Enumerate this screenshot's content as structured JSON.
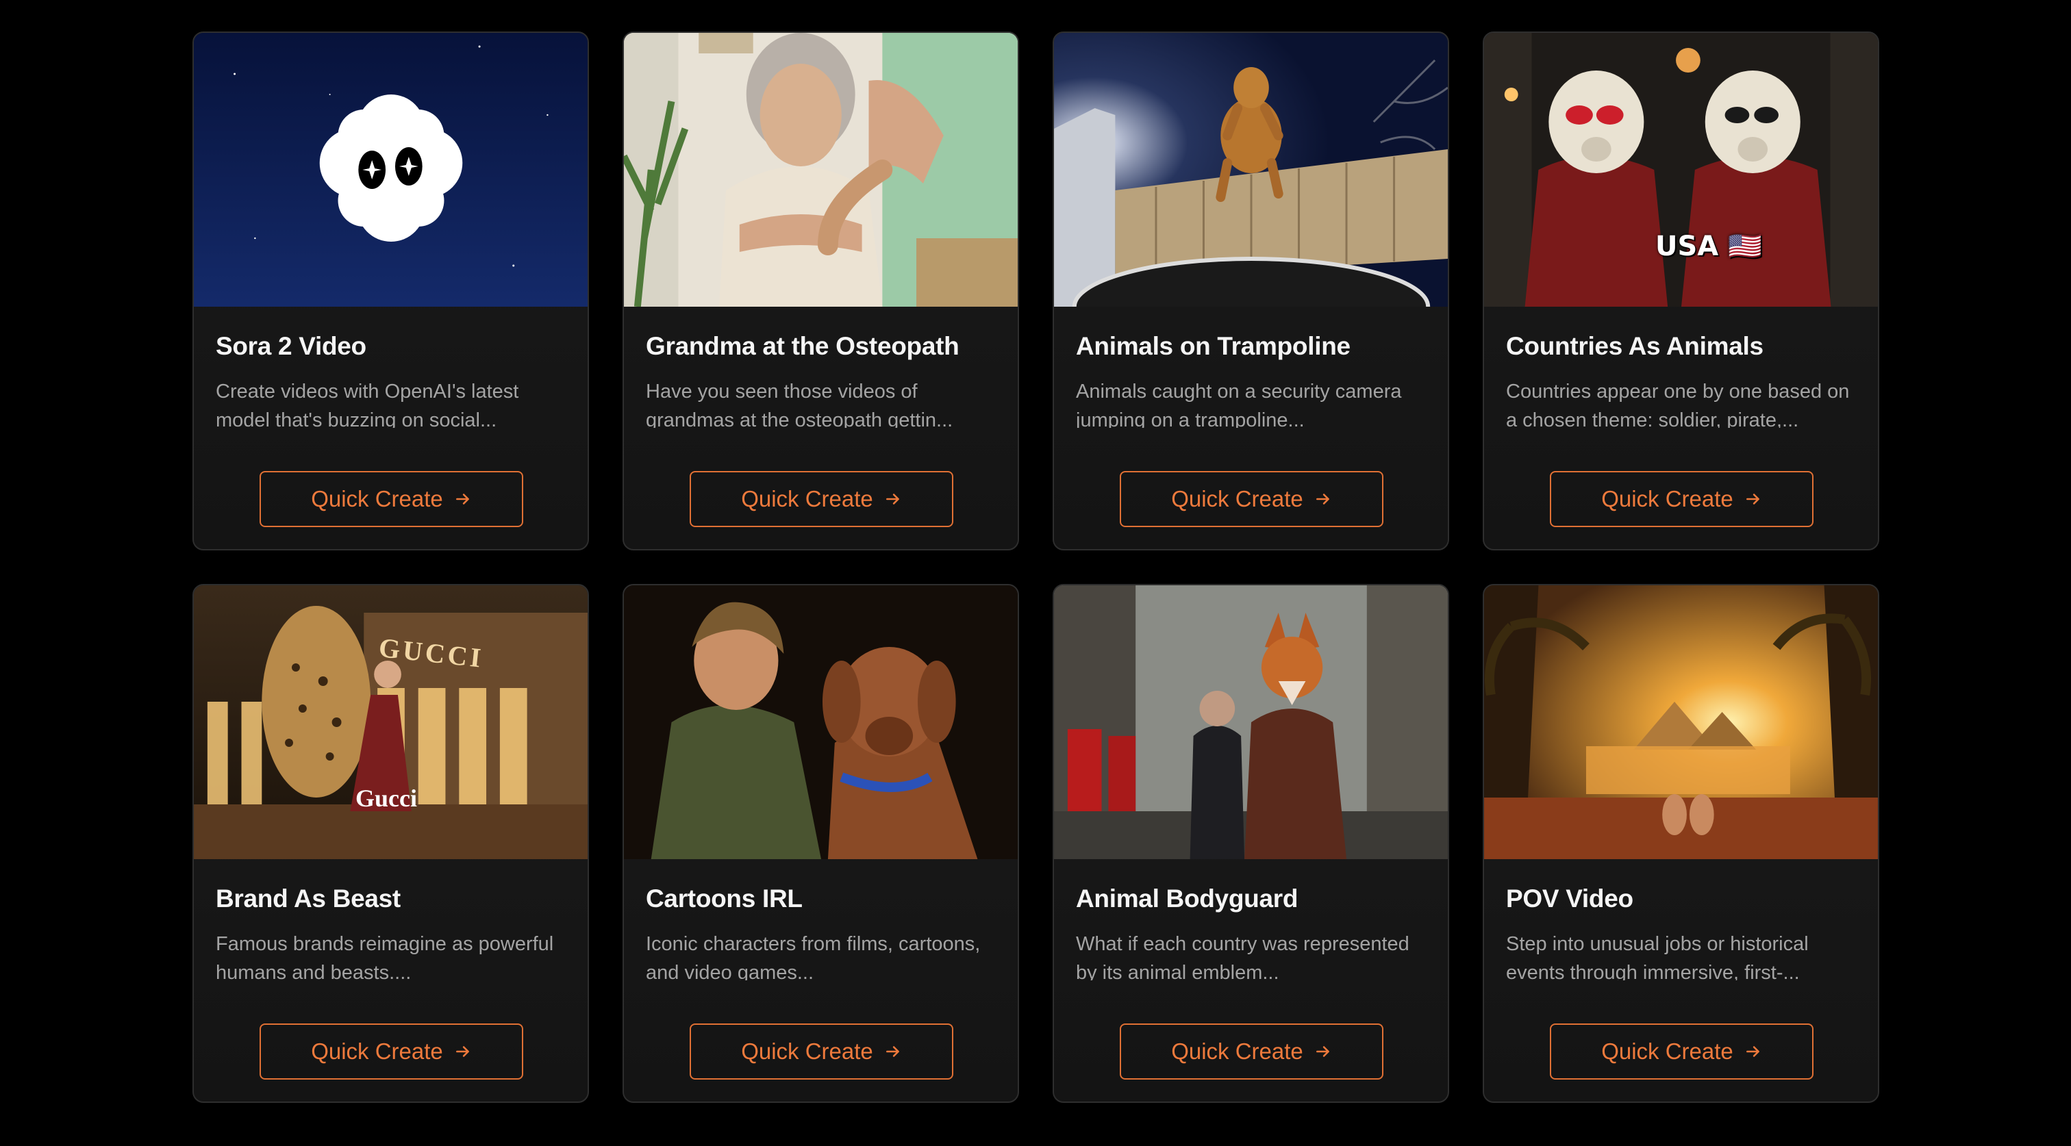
{
  "cards": [
    {
      "title": "Sora 2 Video",
      "desc": "Create videos with OpenAI's latest model that's buzzing on social...",
      "button": "Quick Create",
      "image": "sora-logo-night-sky"
    },
    {
      "title": "Grandma at the Osteopath",
      "desc": "Have you seen those videos of grandmas at the osteopath gettin...",
      "button": "Quick Create",
      "image": "grandma-osteopath-photo"
    },
    {
      "title": "Animals on Trampoline",
      "desc": "Animals caught on a security camera jumping on a trampoline...",
      "button": "Quick Create",
      "image": "dog-trampoline-night"
    },
    {
      "title": "Countries As Animals",
      "desc": "Countries appear one by one based on a chosen theme: soldier, pirate,...",
      "button": "Quick Create",
      "image": "polar-bears-usa",
      "overlay": "USA 🇺🇸"
    },
    {
      "title": "Brand As Beast",
      "desc": "Famous brands reimagine as powerful humans and beasts....",
      "button": "Quick Create",
      "image": "leopard-gucci",
      "overlay": "Gucci",
      "sign": "GUCCI"
    },
    {
      "title": "Cartoons IRL",
      "desc": "Iconic characters from films, cartoons, and video games...",
      "button": "Quick Create",
      "image": "man-and-dog"
    },
    {
      "title": "Animal Bodyguard",
      "desc": "What if each country was represented by its animal emblem...",
      "button": "Quick Create",
      "image": "fox-bodyguard-london"
    },
    {
      "title": "POV Video",
      "desc": "Step into unusual jobs or historical events through immersive, first-...",
      "button": "Quick Create",
      "image": "pov-pyramids-sunset"
    }
  ],
  "colors": {
    "accent": "#e07034",
    "background": "#000000",
    "card": "#181818"
  }
}
